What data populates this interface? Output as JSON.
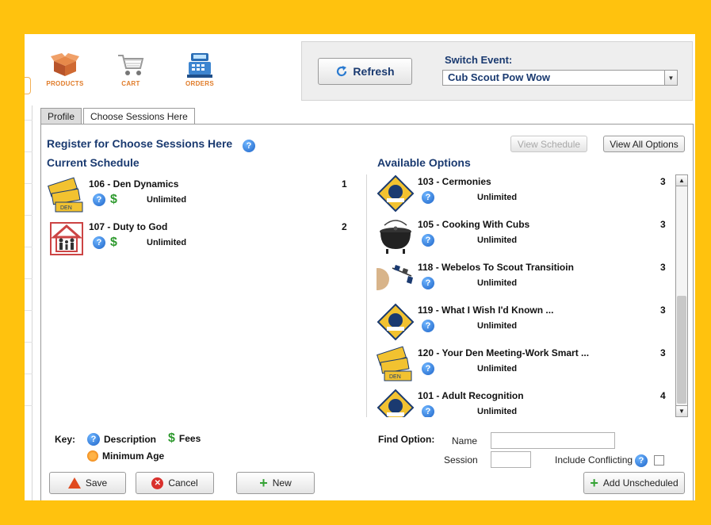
{
  "nav": {
    "products": "PRODUCTS",
    "cart": "CART",
    "orders": "ORDERS"
  },
  "event": {
    "refresh_label": "Refresh",
    "switch_label": "Switch Event:",
    "selected": "Cub Scout Pow Wow"
  },
  "tabs": [
    "Profile",
    "Choose Sessions Here"
  ],
  "register": {
    "title": "Register for Choose Sessions Here",
    "view_schedule": "View Schedule",
    "view_all_options": "View All Options"
  },
  "current": {
    "heading": "Current Schedule",
    "items": [
      {
        "name": "106 - Den Dynamics",
        "availability": "Unlimited",
        "number": "1",
        "icon": "den-tickets-icon"
      },
      {
        "name": "107 - Duty to God",
        "availability": "Unlimited",
        "number": "2",
        "icon": "family-house-icon"
      }
    ]
  },
  "available": {
    "heading": "Available Options",
    "items": [
      {
        "name": "103 - Cermonies",
        "availability": "Unlimited",
        "number": "3",
        "icon": "cub-scout-emblem-icon"
      },
      {
        "name": "105 - Cooking With Cubs",
        "availability": "Unlimited",
        "number": "3",
        "icon": "dutch-oven-icon"
      },
      {
        "name": "118 - Webelos To Scout Transitioin",
        "availability": "Unlimited",
        "number": "3",
        "icon": "webelos-arrow-icon"
      },
      {
        "name": "119 - What I Wish I'd Known ...",
        "availability": "Unlimited",
        "number": "3",
        "icon": "cub-scout-emblem-icon"
      },
      {
        "name": "120 - Your Den Meeting-Work Smart ...",
        "availability": "Unlimited",
        "number": "3",
        "icon": "den-tickets-icon"
      },
      {
        "name": "101 - Adult Recognition",
        "availability": "Unlimited",
        "number": "4",
        "icon": "cub-scout-emblem-icon"
      }
    ]
  },
  "key": {
    "label": "Key:",
    "description": "Description",
    "fees": "Fees",
    "min_age": "Minimum Age"
  },
  "find": {
    "label": "Find Option:",
    "name_label": "Name",
    "session_label": "Session",
    "include_conflicting": "Include Conflicting",
    "name_value": "",
    "session_value": ""
  },
  "buttons": {
    "save": "Save",
    "cancel": "Cancel",
    "new": "New",
    "add_unscheduled": "Add Unscheduled"
  },
  "colors": {
    "frame": "#ffc20e",
    "heading": "#1a3a70",
    "accent_orange": "#e07b28",
    "help_blue": "#1e64c8",
    "fee_green": "#2f9a2f"
  }
}
